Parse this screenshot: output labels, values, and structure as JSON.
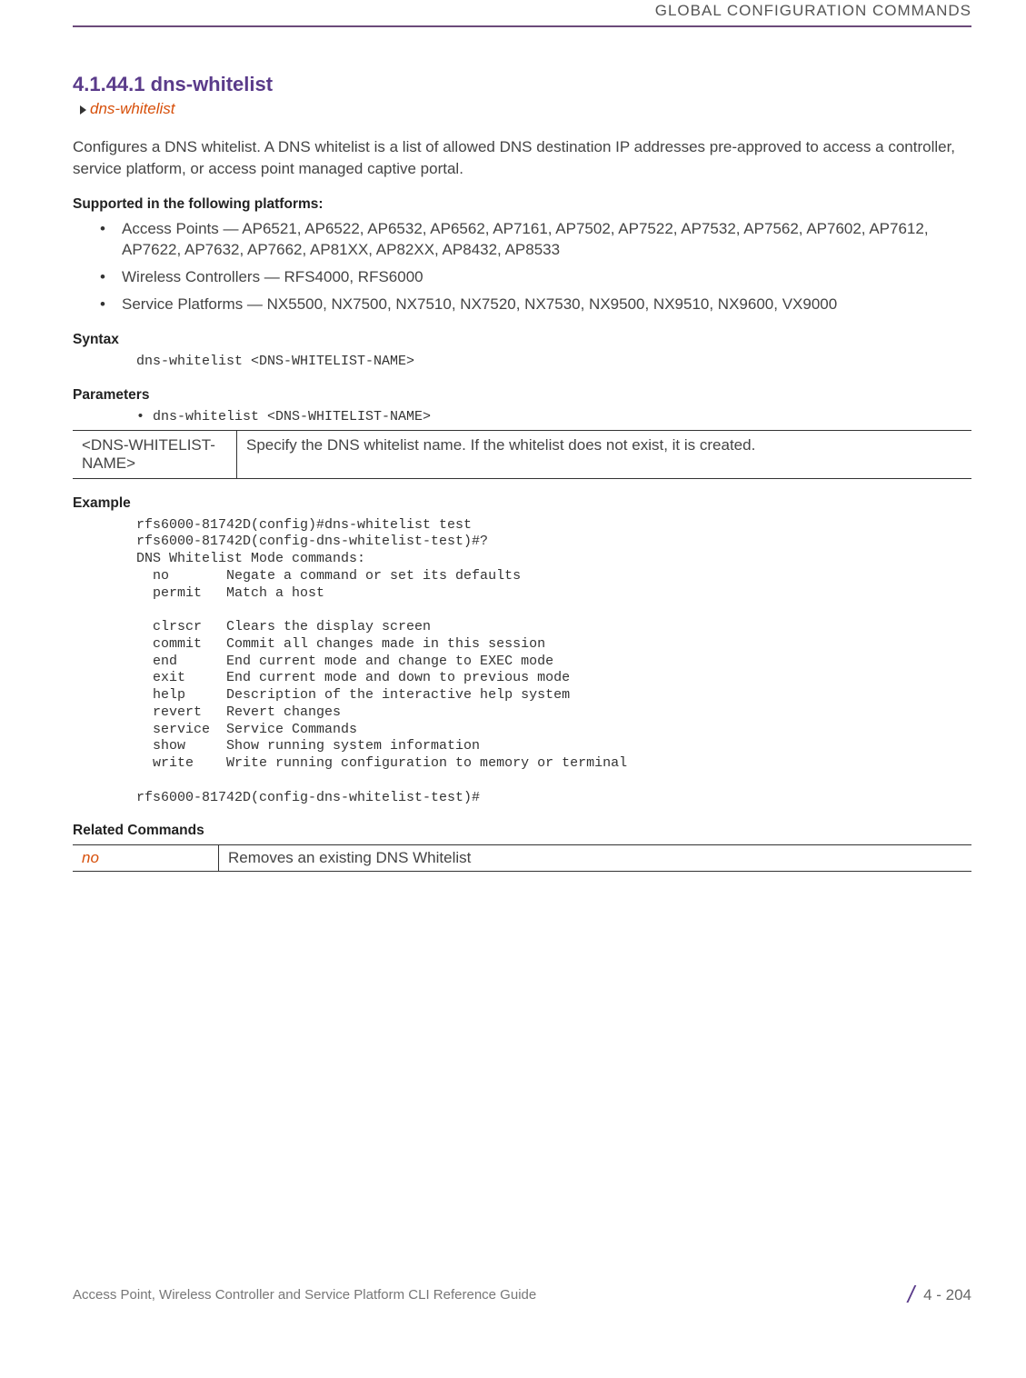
{
  "header": {
    "running_head": "GLOBAL CONFIGURATION COMMANDS"
  },
  "section": {
    "number_title": "4.1.44.1 dns-whitelist",
    "breadcrumb": "dns-whitelist",
    "intro": "Configures a DNS whitelist. A DNS whitelist is a list of allowed DNS destination IP addresses pre-approved to access a controller, service platform, or access point managed captive portal."
  },
  "platforms": {
    "heading": "Supported in the following platforms:",
    "items": [
      "Access Points — AP6521, AP6522, AP6532, AP6562, AP7161, AP7502, AP7522, AP7532, AP7562, AP7602, AP7612, AP7622, AP7632, AP7662, AP81XX, AP82XX, AP8432, AP8533",
      "Wireless Controllers — RFS4000, RFS6000",
      "Service Platforms — NX5500, NX7500, NX7510, NX7520, NX7530, NX9500, NX9510, NX9600, VX9000"
    ]
  },
  "syntax": {
    "heading": "Syntax",
    "code": "dns-whitelist <DNS-WHITELIST-NAME>"
  },
  "parameters": {
    "heading": "Parameters",
    "bullet": "• dns-whitelist <DNS-WHITELIST-NAME>",
    "table": {
      "name": "<DNS-WHITELIST-NAME>",
      "desc": "Specify the DNS whitelist name. If the whitelist does not exist, it is created."
    }
  },
  "example": {
    "heading": "Example",
    "code": "rfs6000-81742D(config)#dns-whitelist test\nrfs6000-81742D(config-dns-whitelist-test)#?\nDNS Whitelist Mode commands:\n  no       Negate a command or set its defaults\n  permit   Match a host\n\n  clrscr   Clears the display screen\n  commit   Commit all changes made in this session\n  end      End current mode and change to EXEC mode\n  exit     End current mode and down to previous mode\n  help     Description of the interactive help system\n  revert   Revert changes\n  service  Service Commands\n  show     Show running system information\n  write    Write running configuration to memory or terminal\n\nrfs6000-81742D(config-dns-whitelist-test)#"
  },
  "related": {
    "heading": "Related Commands",
    "table": {
      "cmd": "no",
      "desc": "Removes an existing DNS Whitelist"
    }
  },
  "footer": {
    "guide": "Access Point, Wireless Controller and Service Platform CLI Reference Guide",
    "page": "4 - 204"
  }
}
